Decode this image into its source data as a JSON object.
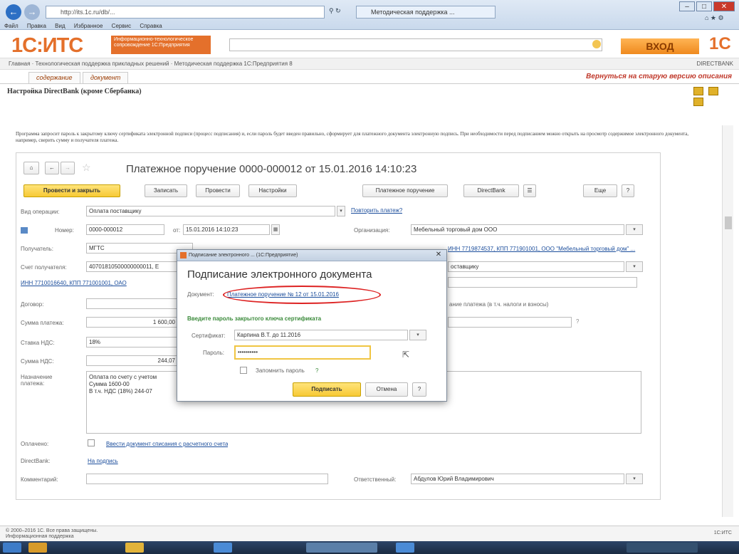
{
  "browser": {
    "address": "http://its.1c.ru/db/...",
    "tab_label": "Методическая поддержка ...",
    "menu": [
      "Файл",
      "Правка",
      "Вид",
      "Избранное",
      "Сервис",
      "Справка"
    ]
  },
  "site": {
    "logo": "1С:ИТС",
    "logo_sub": "Информационно-технологическое сопровождение 1С:Предприятия",
    "login_label": "ВХОД",
    "logo2": "1С",
    "breadcrumb": "Главная · Технологическая поддержка прикладных решений · Методическая поддержка 1С:Предприятия 8",
    "crumbs_right": "DIRECTBANK",
    "tabs": [
      "содержание",
      "документ"
    ],
    "return_link": "Вернуться на старую версию описания",
    "page_heading": "Настройка DirectBank (кроме Сбербанка)",
    "description": "Программа запросит пароль к закрытому ключу сертификата электронной подписи (процесс подписания) и, если пароль будет введен правильно, сформирует для платежного документа электронную подпись. При необходимости перед подписанием можно открыть на просмотр содержимое электронного документа, например, сверить сумму и получателя платежа."
  },
  "form": {
    "title": "Платежное поручение 0000-000012 от 15.01.2016 14:10:23",
    "toolbar": {
      "post_close": "Провести и закрыть",
      "save": "Записать",
      "post": "Провести",
      "settings": "Настройки",
      "payment_order": "Платежное поручение",
      "directbank": "DirectBank",
      "more": "Еще",
      "help": "?"
    },
    "fields": {
      "op_type_label": "Вид операции:",
      "op_type_value": "Оплата поставщику",
      "repeat_payment": "Повторить платеж?",
      "number_label": "Номер:",
      "number_value": "0000-000012",
      "from_label": "от:",
      "date_value": "15.01.2016 14:10:23",
      "org_label": "Организация:",
      "org_value": "Мебельный торговый дом ООО",
      "recipient_label": "Получатель:",
      "recipient_value": "МГТС",
      "inn_right_link": "ИНН 7719874537, КПП 771901001, ООО \"Мебельный торговый дом\" ...",
      "account_label": "Счет получателя:",
      "account_value": "40701810500000000011, Е",
      "right_field2": "оставщику",
      "inn_left_link": "ИНН 7710016640, КПП 771001001, ОАО",
      "contract_label": "Договор:",
      "sum_label": "Сумма платежа:",
      "sum_value": "1 600,00",
      "vat_rate_label": "Ставка НДС:",
      "vat_rate_value": "18%",
      "vat_sum_label": "Сумма НДС:",
      "vat_sum_value": "244,07",
      "purpose_label": "Назначение платежа:",
      "purpose_text": "Оплата по счету с учетом\nСумма 1600-00\nВ т.ч. НДС (18%) 244-07",
      "right_note": "ание платежа (в т.ч. налоги и взносы)",
      "paid_label": "Оплачено:",
      "paid_link": "Ввести документ списания с расчетного счета",
      "directbank_label": "DirectBank:",
      "directbank_link": "На подпись",
      "comment_label": "Комментарий:",
      "responsible_label": "Ответственный:",
      "responsible_value": "Абдулов Юрий Владимирович"
    }
  },
  "modal": {
    "titlebar": "Подписание электронного ... (1С:Предприятие)",
    "title": "Подписание электронного документа",
    "doc_label": "Документ:",
    "doc_link": "Платежное поручение № 12 от 15.01.2016",
    "hint": "Введите пароль закрытого ключа сертификата",
    "cert_label": "Сертификат:",
    "cert_value": "Карпина В.Т. до 11.2016",
    "password_label": "Пароль:",
    "password_value": "••••••••••",
    "remember_label": "Запомнить пароль",
    "remember_help": "?",
    "sign_button": "Подписать",
    "cancel_button": "Отмена",
    "help_button": "?"
  },
  "status": {
    "left": "© 2000–2016 1С. Все права защищены.\nИнформационная поддержка",
    "right": "1С:ИТС"
  },
  "colors": {
    "brand_orange": "#e4702b",
    "primary_yellow": "#f7c935",
    "link_blue": "#1c4e9c",
    "highlight_red": "#d22"
  }
}
